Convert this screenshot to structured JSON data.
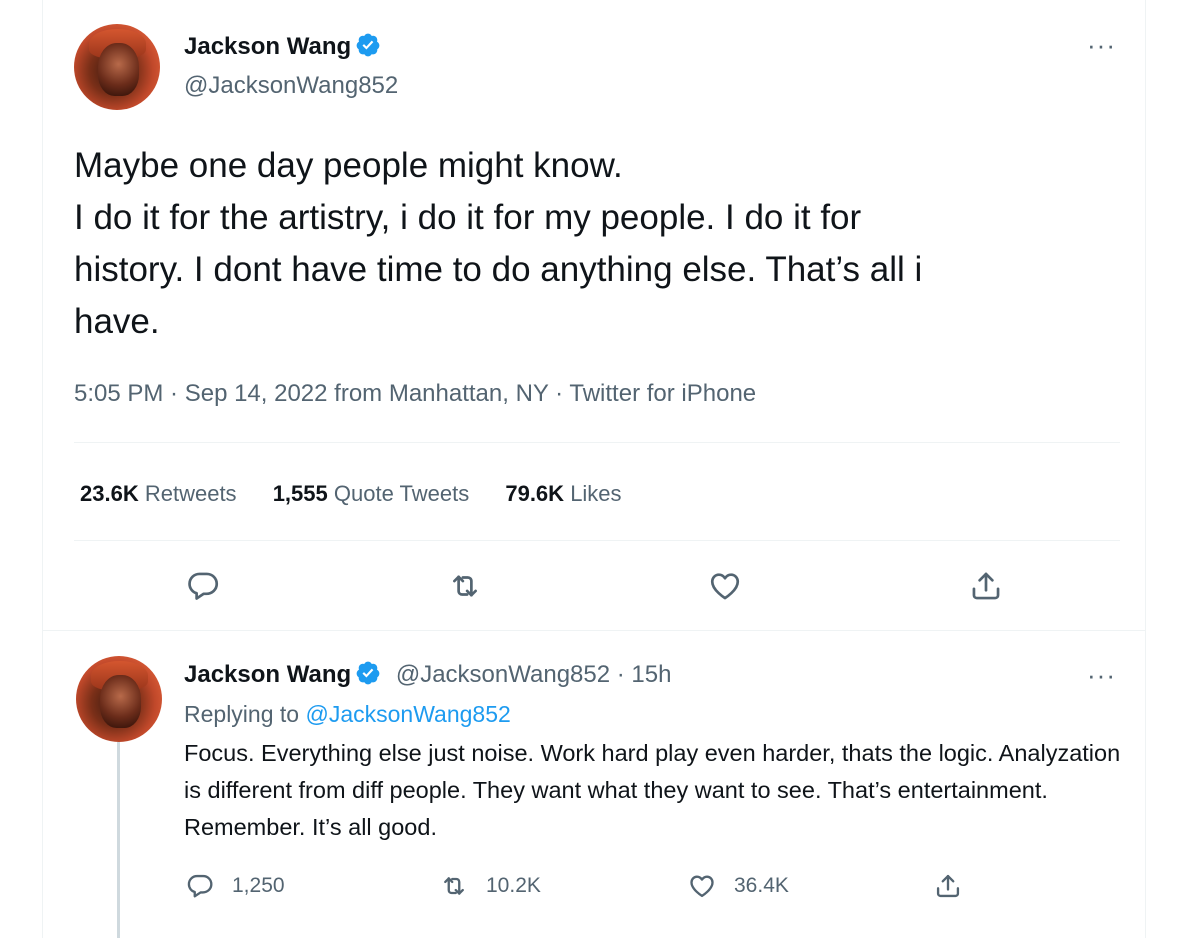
{
  "tweet": {
    "author_name": "Jackson Wang",
    "author_handle": "@JacksonWang852",
    "more_label": "···",
    "text_lines": [
      "Maybe one day people might know.",
      "I do it for the artistry, i do it for my people. I do it for",
      "history. I dont have time to do anything else. That’s all i",
      "have."
    ],
    "meta": "5:05 PM · Sep 14, 2022 from Manhattan, NY · Twitter for iPhone",
    "stats": {
      "retweets_count": "23.6K",
      "retweets_label": "Retweets",
      "quotes_count": "1,555",
      "quotes_label": "Quote Tweets",
      "likes_count": "79.6K",
      "likes_label": "Likes"
    },
    "actions": [
      "reply-icon",
      "retweet-icon",
      "like-icon",
      "share-icon"
    ]
  },
  "reply": {
    "author_name": "Jackson Wang",
    "author_handle_time": "@JacksonWang852 · 15h",
    "more_label": "···",
    "replying_prefix": "Replying to",
    "replying_handle": "@JacksonWang852",
    "text": "Focus. Everything else just noise. Work hard play even harder, thats the logic. Analyzation is different from diff people. They want what they want to see. That’s entertainment. Remember. It’s all good.",
    "reply_count": "1,250",
    "retweet_count": "10.2K",
    "like_count": "36.4K"
  },
  "colors": {
    "text_primary": "#0f1419",
    "text_secondary": "#536471",
    "accent": "#1d9bf0",
    "divider": "#eff3f4"
  }
}
